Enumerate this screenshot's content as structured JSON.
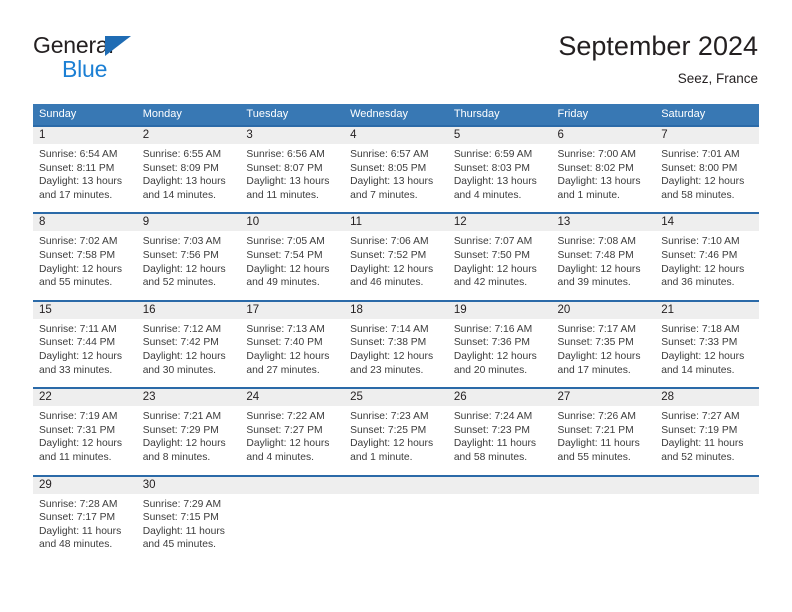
{
  "brand": {
    "name_part1": "General",
    "name_part2": "Blue",
    "triangle_color": "#1f6cb4",
    "blue_color": "#1b7fd4"
  },
  "header": {
    "title": "September 2024",
    "subtitle": "Seez, France"
  },
  "colors": {
    "header_row_bg": "#3878b4",
    "week_divider": "#2b6aa8",
    "daynum_bg": "#eeeeee",
    "text": "#231f20"
  },
  "weekday_headers": [
    "Sunday",
    "Monday",
    "Tuesday",
    "Wednesday",
    "Thursday",
    "Friday",
    "Saturday"
  ],
  "weeks": [
    [
      {
        "day": "1",
        "sunrise": "Sunrise: 6:54 AM",
        "sunset": "Sunset: 8:11 PM",
        "daylight_line1": "Daylight: 13 hours",
        "daylight_line2": "and 17 minutes."
      },
      {
        "day": "2",
        "sunrise": "Sunrise: 6:55 AM",
        "sunset": "Sunset: 8:09 PM",
        "daylight_line1": "Daylight: 13 hours",
        "daylight_line2": "and 14 minutes."
      },
      {
        "day": "3",
        "sunrise": "Sunrise: 6:56 AM",
        "sunset": "Sunset: 8:07 PM",
        "daylight_line1": "Daylight: 13 hours",
        "daylight_line2": "and 11 minutes."
      },
      {
        "day": "4",
        "sunrise": "Sunrise: 6:57 AM",
        "sunset": "Sunset: 8:05 PM",
        "daylight_line1": "Daylight: 13 hours",
        "daylight_line2": "and 7 minutes."
      },
      {
        "day": "5",
        "sunrise": "Sunrise: 6:59 AM",
        "sunset": "Sunset: 8:03 PM",
        "daylight_line1": "Daylight: 13 hours",
        "daylight_line2": "and 4 minutes."
      },
      {
        "day": "6",
        "sunrise": "Sunrise: 7:00 AM",
        "sunset": "Sunset: 8:02 PM",
        "daylight_line1": "Daylight: 13 hours",
        "daylight_line2": "and 1 minute."
      },
      {
        "day": "7",
        "sunrise": "Sunrise: 7:01 AM",
        "sunset": "Sunset: 8:00 PM",
        "daylight_line1": "Daylight: 12 hours",
        "daylight_line2": "and 58 minutes."
      }
    ],
    [
      {
        "day": "8",
        "sunrise": "Sunrise: 7:02 AM",
        "sunset": "Sunset: 7:58 PM",
        "daylight_line1": "Daylight: 12 hours",
        "daylight_line2": "and 55 minutes."
      },
      {
        "day": "9",
        "sunrise": "Sunrise: 7:03 AM",
        "sunset": "Sunset: 7:56 PM",
        "daylight_line1": "Daylight: 12 hours",
        "daylight_line2": "and 52 minutes."
      },
      {
        "day": "10",
        "sunrise": "Sunrise: 7:05 AM",
        "sunset": "Sunset: 7:54 PM",
        "daylight_line1": "Daylight: 12 hours",
        "daylight_line2": "and 49 minutes."
      },
      {
        "day": "11",
        "sunrise": "Sunrise: 7:06 AM",
        "sunset": "Sunset: 7:52 PM",
        "daylight_line1": "Daylight: 12 hours",
        "daylight_line2": "and 46 minutes."
      },
      {
        "day": "12",
        "sunrise": "Sunrise: 7:07 AM",
        "sunset": "Sunset: 7:50 PM",
        "daylight_line1": "Daylight: 12 hours",
        "daylight_line2": "and 42 minutes."
      },
      {
        "day": "13",
        "sunrise": "Sunrise: 7:08 AM",
        "sunset": "Sunset: 7:48 PM",
        "daylight_line1": "Daylight: 12 hours",
        "daylight_line2": "and 39 minutes."
      },
      {
        "day": "14",
        "sunrise": "Sunrise: 7:10 AM",
        "sunset": "Sunset: 7:46 PM",
        "daylight_line1": "Daylight: 12 hours",
        "daylight_line2": "and 36 minutes."
      }
    ],
    [
      {
        "day": "15",
        "sunrise": "Sunrise: 7:11 AM",
        "sunset": "Sunset: 7:44 PM",
        "daylight_line1": "Daylight: 12 hours",
        "daylight_line2": "and 33 minutes."
      },
      {
        "day": "16",
        "sunrise": "Sunrise: 7:12 AM",
        "sunset": "Sunset: 7:42 PM",
        "daylight_line1": "Daylight: 12 hours",
        "daylight_line2": "and 30 minutes."
      },
      {
        "day": "17",
        "sunrise": "Sunrise: 7:13 AM",
        "sunset": "Sunset: 7:40 PM",
        "daylight_line1": "Daylight: 12 hours",
        "daylight_line2": "and 27 minutes."
      },
      {
        "day": "18",
        "sunrise": "Sunrise: 7:14 AM",
        "sunset": "Sunset: 7:38 PM",
        "daylight_line1": "Daylight: 12 hours",
        "daylight_line2": "and 23 minutes."
      },
      {
        "day": "19",
        "sunrise": "Sunrise: 7:16 AM",
        "sunset": "Sunset: 7:36 PM",
        "daylight_line1": "Daylight: 12 hours",
        "daylight_line2": "and 20 minutes."
      },
      {
        "day": "20",
        "sunrise": "Sunrise: 7:17 AM",
        "sunset": "Sunset: 7:35 PM",
        "daylight_line1": "Daylight: 12 hours",
        "daylight_line2": "and 17 minutes."
      },
      {
        "day": "21",
        "sunrise": "Sunrise: 7:18 AM",
        "sunset": "Sunset: 7:33 PM",
        "daylight_line1": "Daylight: 12 hours",
        "daylight_line2": "and 14 minutes."
      }
    ],
    [
      {
        "day": "22",
        "sunrise": "Sunrise: 7:19 AM",
        "sunset": "Sunset: 7:31 PM",
        "daylight_line1": "Daylight: 12 hours",
        "daylight_line2": "and 11 minutes."
      },
      {
        "day": "23",
        "sunrise": "Sunrise: 7:21 AM",
        "sunset": "Sunset: 7:29 PM",
        "daylight_line1": "Daylight: 12 hours",
        "daylight_line2": "and 8 minutes."
      },
      {
        "day": "24",
        "sunrise": "Sunrise: 7:22 AM",
        "sunset": "Sunset: 7:27 PM",
        "daylight_line1": "Daylight: 12 hours",
        "daylight_line2": "and 4 minutes."
      },
      {
        "day": "25",
        "sunrise": "Sunrise: 7:23 AM",
        "sunset": "Sunset: 7:25 PM",
        "daylight_line1": "Daylight: 12 hours",
        "daylight_line2": "and 1 minute."
      },
      {
        "day": "26",
        "sunrise": "Sunrise: 7:24 AM",
        "sunset": "Sunset: 7:23 PM",
        "daylight_line1": "Daylight: 11 hours",
        "daylight_line2": "and 58 minutes."
      },
      {
        "day": "27",
        "sunrise": "Sunrise: 7:26 AM",
        "sunset": "Sunset: 7:21 PM",
        "daylight_line1": "Daylight: 11 hours",
        "daylight_line2": "and 55 minutes."
      },
      {
        "day": "28",
        "sunrise": "Sunrise: 7:27 AM",
        "sunset": "Sunset: 7:19 PM",
        "daylight_line1": "Daylight: 11 hours",
        "daylight_line2": "and 52 minutes."
      }
    ],
    [
      {
        "day": "29",
        "sunrise": "Sunrise: 7:28 AM",
        "sunset": "Sunset: 7:17 PM",
        "daylight_line1": "Daylight: 11 hours",
        "daylight_line2": "and 48 minutes."
      },
      {
        "day": "30",
        "sunrise": "Sunrise: 7:29 AM",
        "sunset": "Sunset: 7:15 PM",
        "daylight_line1": "Daylight: 11 hours",
        "daylight_line2": "and 45 minutes."
      },
      {
        "day": "",
        "sunrise": "",
        "sunset": "",
        "daylight_line1": "",
        "daylight_line2": ""
      },
      {
        "day": "",
        "sunrise": "",
        "sunset": "",
        "daylight_line1": "",
        "daylight_line2": ""
      },
      {
        "day": "",
        "sunrise": "",
        "sunset": "",
        "daylight_line1": "",
        "daylight_line2": ""
      },
      {
        "day": "",
        "sunrise": "",
        "sunset": "",
        "daylight_line1": "",
        "daylight_line2": ""
      },
      {
        "day": "",
        "sunrise": "",
        "sunset": "",
        "daylight_line1": "",
        "daylight_line2": ""
      }
    ]
  ]
}
